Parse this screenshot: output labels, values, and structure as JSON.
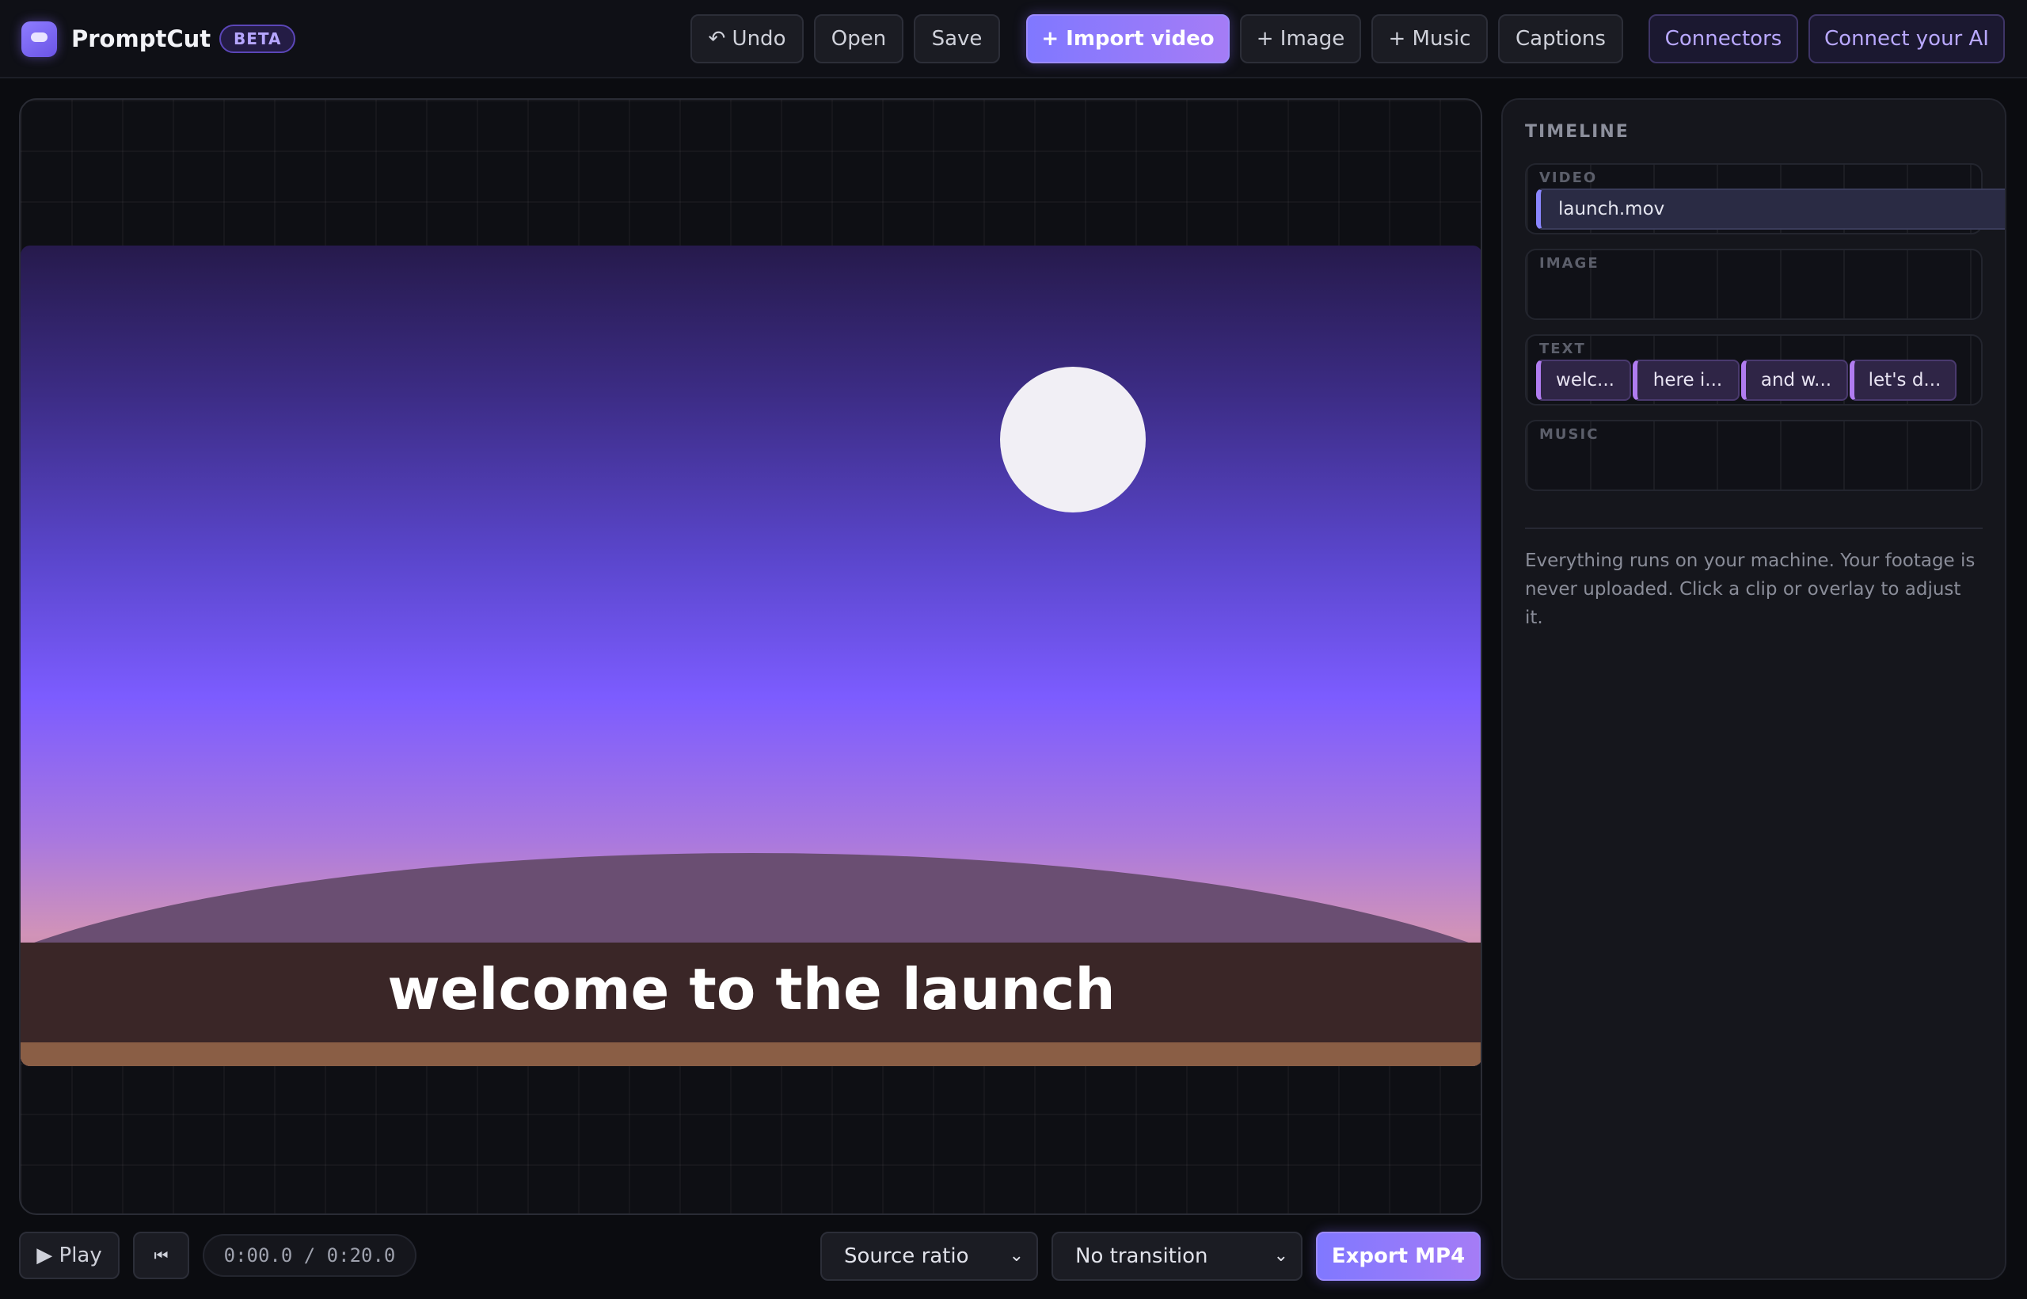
{
  "app": {
    "name": "PromptCut",
    "badge": "BETA"
  },
  "toolbar": {
    "undo": "↶ Undo",
    "open": "Open",
    "save": "Save",
    "import_video": "+ Import video",
    "image": "+ Image",
    "music": "+ Music",
    "captions": "Captions",
    "connectors": "Connectors",
    "connect_ai": "Connect your AI"
  },
  "preview": {
    "caption": "welcome to the launch"
  },
  "controls": {
    "play": "▶ Play",
    "rewind": "⏮",
    "timecode": "0:00.0 / 0:20.0",
    "ratio": "Source ratio",
    "transition": "No transition",
    "export": "Export MP4"
  },
  "timeline": {
    "title": "TIMELINE",
    "tracks": {
      "video": {
        "label": "VIDEO",
        "clips": [
          "launch.mov"
        ]
      },
      "image": {
        "label": "IMAGE"
      },
      "text": {
        "label": "TEXT",
        "clips": [
          "welc...",
          "here i...",
          "and w...",
          "let's d..."
        ]
      },
      "music": {
        "label": "MUSIC"
      }
    },
    "info": "Everything runs on your machine. Your footage is never uploaded. Click a clip or overlay to adjust it."
  },
  "colors": {
    "accent": "#8078ff",
    "accent_end": "#a57cf6",
    "background": "#0b0c10",
    "text_clip": "#b07cf0"
  }
}
